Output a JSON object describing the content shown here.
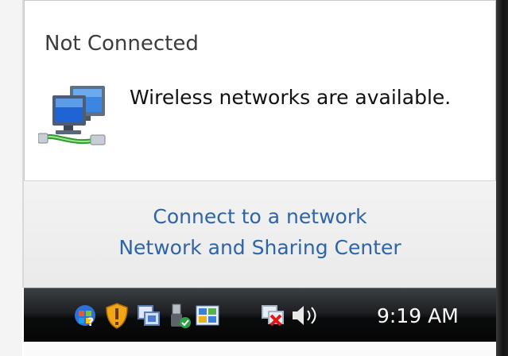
{
  "flyout": {
    "status_title": "Not Connected",
    "status_message": "Wireless networks are available.",
    "links": {
      "connect": "Connect to a network",
      "sharing_center": "Network and Sharing Center"
    },
    "icon": "network-computers-icon"
  },
  "taskbar": {
    "clock": "9:19 AM",
    "tray_icons": [
      "windows-help-icon",
      "security-shield-icon",
      "network-adapter-icon",
      "usb-safely-remove-icon",
      "windows-update-icon",
      "network-disconnected-icon",
      "volume-icon"
    ]
  },
  "colors": {
    "link": "#2e64a8",
    "taskbar": "#111214",
    "text": "#3c3c3c"
  }
}
